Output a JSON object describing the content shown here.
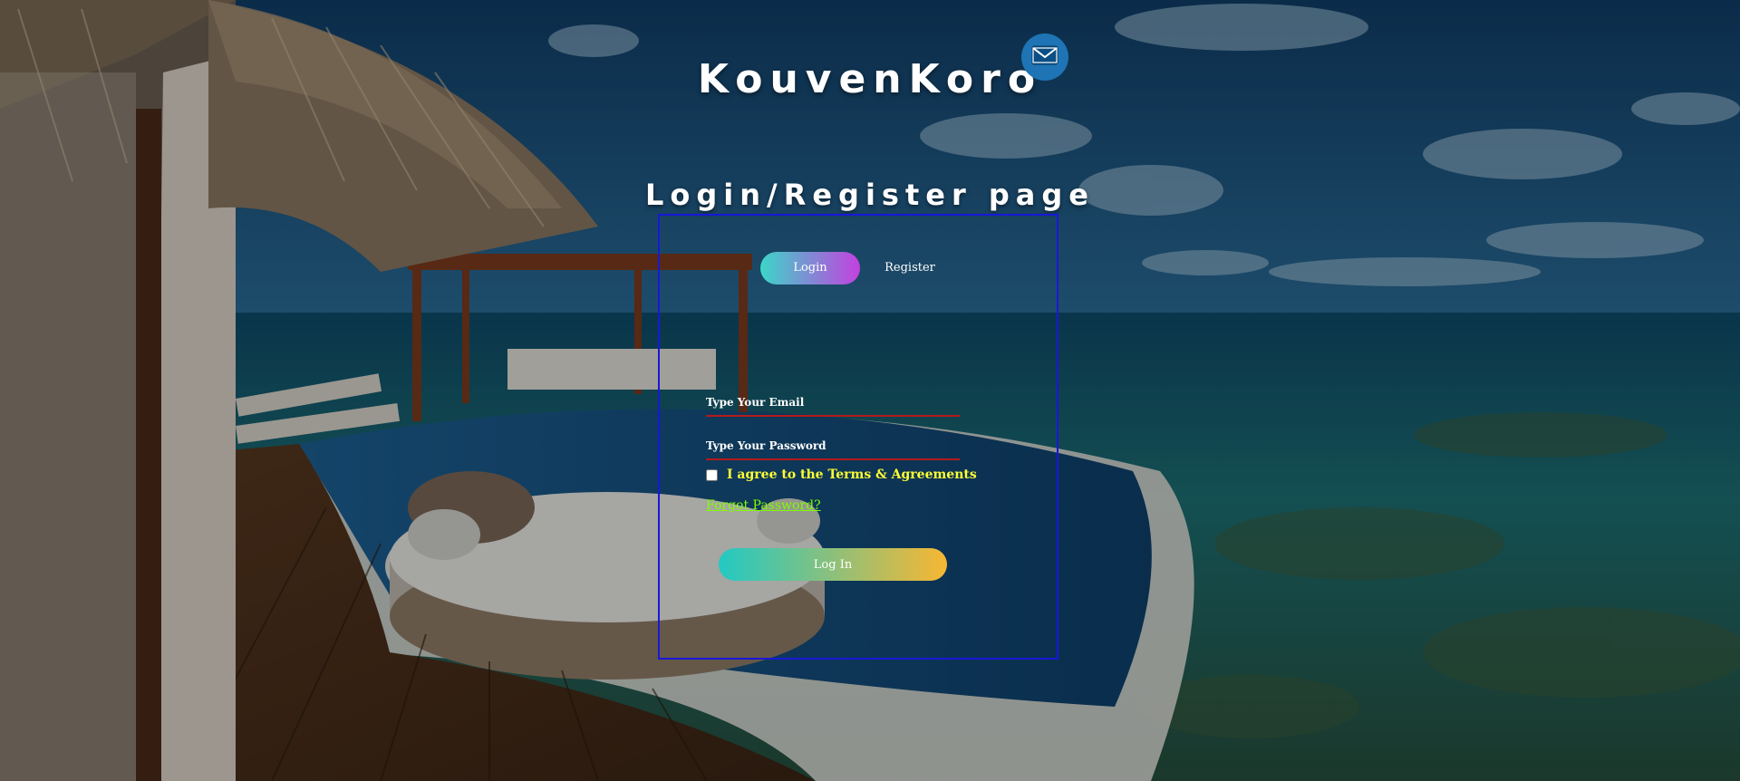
{
  "brand": {
    "name": "KouvenKoro"
  },
  "header": {
    "page_title": "Login/Register page"
  },
  "toggle": {
    "login_label": "Login",
    "register_label": "Register",
    "active": "Login"
  },
  "form": {
    "email_placeholder": "Type Your Email",
    "password_placeholder": "Type Your Password",
    "terms_label": "I agree to the Terms & Agreements",
    "forgot_label": "Forgot Password?",
    "submit_label": "Log In"
  },
  "colors": {
    "form_border": "#1818d8",
    "field_underline": "#b31b1b",
    "terms_text": "#ffff33",
    "forgot_link": "#7fff00",
    "toggle_gradient": [
      "#3cd6c8",
      "#c440e0"
    ],
    "submit_gradient": [
      "#22c9c3",
      "#f7b733"
    ],
    "mail_button": "#1e74b5"
  },
  "icons": {
    "mail": "envelope-icon"
  }
}
